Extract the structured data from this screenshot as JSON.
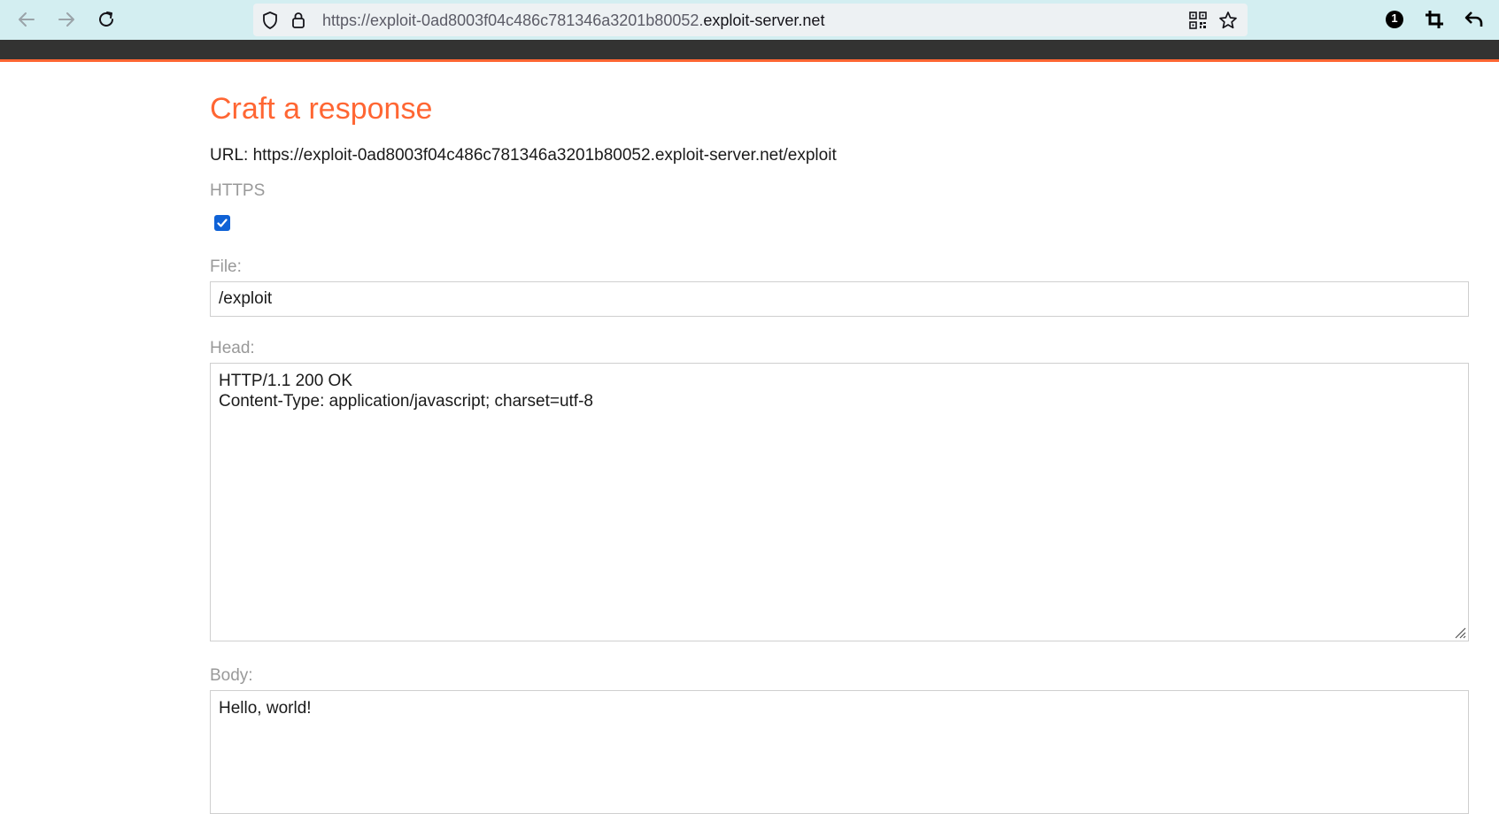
{
  "browser": {
    "url_prefix": "https://exploit-0ad8003f04c486c781346a3201b80052.",
    "url_domain": "exploit-server.net",
    "notification_count": "1"
  },
  "page": {
    "title": "Craft a response",
    "url_label": "URL: https://exploit-0ad8003f04c486c781346a3201b80052.exploit-server.net/exploit",
    "https_label": "HTTPS",
    "https_checked": true,
    "file_label": "File:",
    "file_value": "/exploit",
    "head_label": "Head:",
    "head_lines": [
      "HTTP/1.1 200 OK",
      "Content-Type: application/javascript; charset=utf-8"
    ],
    "body_label": "Body:",
    "body_value": "Hello, world!"
  },
  "colors": {
    "accent": "#ff6633",
    "browser_bar": "#d3eef1",
    "header_dark": "#333332",
    "checkbox_blue": "#0f62d6"
  },
  "icons": [
    "back-arrow-icon",
    "forward-arrow-icon",
    "reload-icon",
    "shield-icon",
    "lock-icon",
    "qr-code-icon",
    "star-icon",
    "extension-badge-icon",
    "crop-icon",
    "undo-icon",
    "checkmark-icon",
    "resize-grip-icon"
  ]
}
